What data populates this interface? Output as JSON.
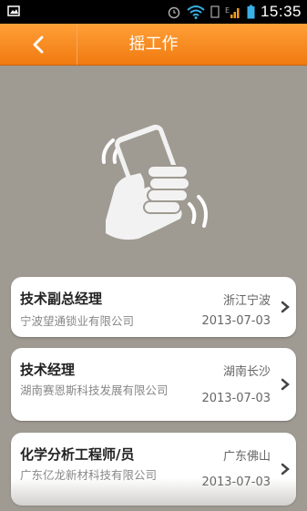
{
  "status": {
    "time": "15:35"
  },
  "header": {
    "title": "摇工作"
  },
  "jobs": [
    {
      "title": "技术副总经理",
      "location": "浙江宁波",
      "company": "宁波望通锁业有限公司",
      "date": "2013-07-03"
    },
    {
      "title": "技术经理",
      "location": "湖南长沙",
      "company": "湖南赛恩斯科技发展有限公司",
      "date": "2013-07-03"
    },
    {
      "title": "化学分析工程师/员",
      "location": "广东佛山",
      "company": "广东亿龙新材科技有限公司",
      "date": "2013-07-03"
    }
  ],
  "colors": {
    "header": "#f58a1f",
    "background": "#9f9a92"
  }
}
